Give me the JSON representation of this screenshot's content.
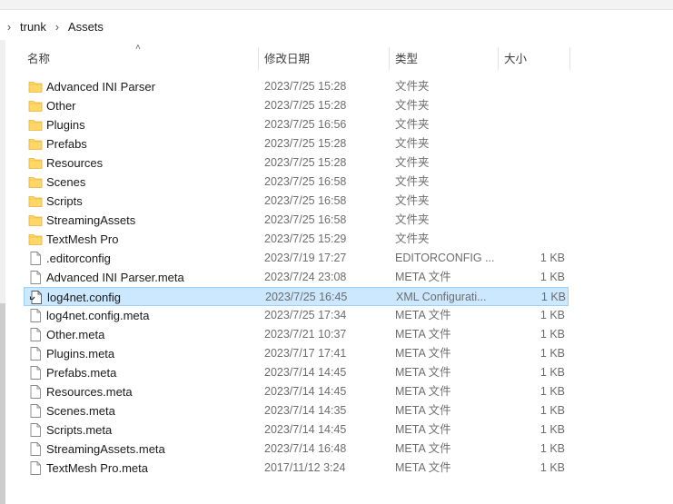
{
  "breadcrumb": {
    "items": [
      "trunk",
      "Assets"
    ]
  },
  "columns": {
    "name": "名称",
    "date": "修改日期",
    "type": "类型",
    "size": "大小"
  },
  "files": [
    {
      "name": "Advanced INI Parser",
      "date": "2023/7/25 15:28",
      "type": "文件夹",
      "size": "",
      "icon": "folder-icon",
      "selected": false
    },
    {
      "name": "Other",
      "date": "2023/7/25 15:28",
      "type": "文件夹",
      "size": "",
      "icon": "folder-icon",
      "selected": false
    },
    {
      "name": "Plugins",
      "date": "2023/7/25 16:56",
      "type": "文件夹",
      "size": "",
      "icon": "folder-icon",
      "selected": false
    },
    {
      "name": "Prefabs",
      "date": "2023/7/25 15:28",
      "type": "文件夹",
      "size": "",
      "icon": "folder-icon",
      "selected": false
    },
    {
      "name": "Resources",
      "date": "2023/7/25 15:28",
      "type": "文件夹",
      "size": "",
      "icon": "folder-icon",
      "selected": false
    },
    {
      "name": "Scenes",
      "date": "2023/7/25 16:58",
      "type": "文件夹",
      "size": "",
      "icon": "folder-icon",
      "selected": false
    },
    {
      "name": "Scripts",
      "date": "2023/7/25 16:58",
      "type": "文件夹",
      "size": "",
      "icon": "folder-icon",
      "selected": false
    },
    {
      "name": "StreamingAssets",
      "date": "2023/7/25 16:58",
      "type": "文件夹",
      "size": "",
      "icon": "folder-icon",
      "selected": false
    },
    {
      "name": "TextMesh Pro",
      "date": "2023/7/25 15:29",
      "type": "文件夹",
      "size": "",
      "icon": "folder-icon",
      "selected": false
    },
    {
      "name": ".editorconfig",
      "date": "2023/7/19 17:27",
      "type": "EDITORCONFIG ...",
      "size": "1 KB",
      "icon": "file-icon",
      "selected": false
    },
    {
      "name": "Advanced INI Parser.meta",
      "date": "2023/7/24 23:08",
      "type": "META 文件",
      "size": "1 KB",
      "icon": "file-icon",
      "selected": false
    },
    {
      "name": "log4net.config",
      "date": "2023/7/25 16:45",
      "type": "XML Configurati...",
      "size": "1 KB",
      "icon": "config-file-icon",
      "selected": true
    },
    {
      "name": "log4net.config.meta",
      "date": "2023/7/25 17:34",
      "type": "META 文件",
      "size": "1 KB",
      "icon": "file-icon",
      "selected": false
    },
    {
      "name": "Other.meta",
      "date": "2023/7/21 10:37",
      "type": "META 文件",
      "size": "1 KB",
      "icon": "file-icon",
      "selected": false
    },
    {
      "name": "Plugins.meta",
      "date": "2023/7/17 17:41",
      "type": "META 文件",
      "size": "1 KB",
      "icon": "file-icon",
      "selected": false
    },
    {
      "name": "Prefabs.meta",
      "date": "2023/7/14 14:45",
      "type": "META 文件",
      "size": "1 KB",
      "icon": "file-icon",
      "selected": false
    },
    {
      "name": "Resources.meta",
      "date": "2023/7/14 14:45",
      "type": "META 文件",
      "size": "1 KB",
      "icon": "file-icon",
      "selected": false
    },
    {
      "name": "Scenes.meta",
      "date": "2023/7/14 14:35",
      "type": "META 文件",
      "size": "1 KB",
      "icon": "file-icon",
      "selected": false
    },
    {
      "name": "Scripts.meta",
      "date": "2023/7/14 14:45",
      "type": "META 文件",
      "size": "1 KB",
      "icon": "file-icon",
      "selected": false
    },
    {
      "name": "StreamingAssets.meta",
      "date": "2023/7/14 16:48",
      "type": "META 文件",
      "size": "1 KB",
      "icon": "file-icon",
      "selected": false
    },
    {
      "name": "TextMesh Pro.meta",
      "date": "2017/11/12 3:24",
      "type": "META 文件",
      "size": "1 KB",
      "icon": "file-icon",
      "selected": false
    }
  ],
  "colors": {
    "selection_bg": "#cce8ff",
    "selection_border": "#99d1ff",
    "folder": "#ffd766"
  }
}
